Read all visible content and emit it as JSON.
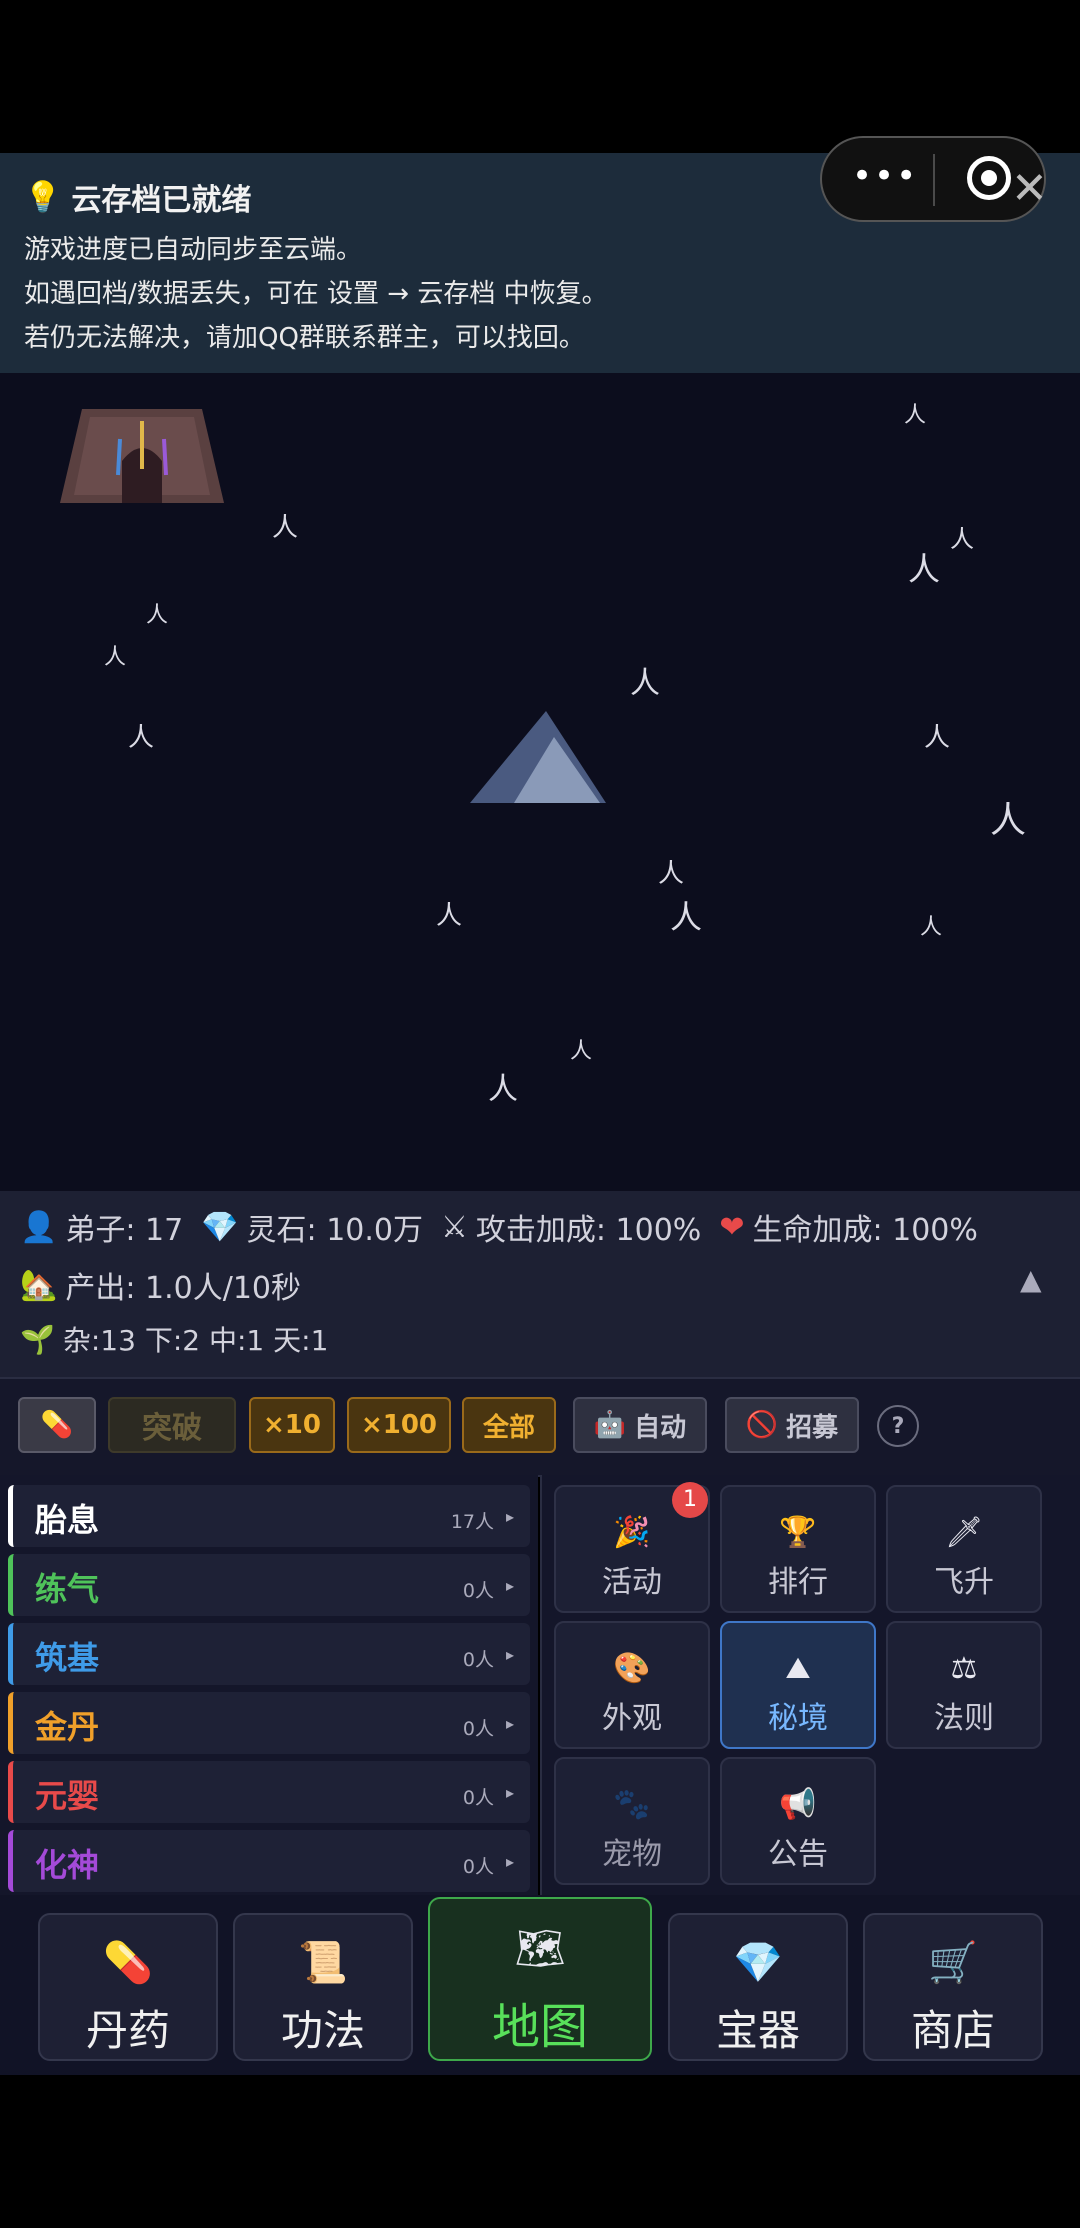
{
  "notice": {
    "title": "云存档已就绪",
    "icon": "lightbulb-icon",
    "lines": [
      "游戏进度已自动同步至云端。",
      "如遇回档/数据丢失，可在 设置 → 云存档 中恢复。",
      "若仍无法解决，请加QQ群联系群主，可以找回。"
    ]
  },
  "capsule": {
    "more": "•••",
    "close": "✕"
  },
  "map": {
    "disciple_glyph": "人"
  },
  "stats": {
    "disciples": "弟子: 17",
    "spirit_stones": "灵石: 10.0万",
    "attack_bonus": "攻击加成: 100%",
    "hp_bonus": "生命加成: 100%",
    "production": "产出: 1.0人/10秒",
    "grades": "杂:13 下:2 中:1 天:1",
    "collapse": "▲"
  },
  "toolbar": {
    "breakthrough": "突破",
    "x10": "×10",
    "x100": "×100",
    "all": "全部",
    "auto": "自动",
    "recruit": "招募",
    "help": "?"
  },
  "realms": [
    {
      "name": "胎息",
      "count": "17人",
      "color": "#ffffff"
    },
    {
      "name": "练气",
      "count": "0人",
      "color": "#4fc35a"
    },
    {
      "name": "筑基",
      "count": "0人",
      "color": "#3f9be8"
    },
    {
      "name": "金丹",
      "count": "0人",
      "color": "#f0a02a"
    },
    {
      "name": "元婴",
      "count": "0人",
      "color": "#e84a4a"
    },
    {
      "name": "化神",
      "count": "0人",
      "color": "#a44ad8"
    }
  ],
  "grid": {
    "activity": "活动",
    "activity_badge": "1",
    "ranking": "排行",
    "ascend": "飞升",
    "appearance": "外观",
    "secret_realm": "秘境",
    "law": "法则",
    "pet": "宠物",
    "announcement": "公告"
  },
  "nav": {
    "pills": "丹药",
    "techniques": "功法",
    "map": "地图",
    "treasures": "宝器",
    "shop": "商店"
  }
}
